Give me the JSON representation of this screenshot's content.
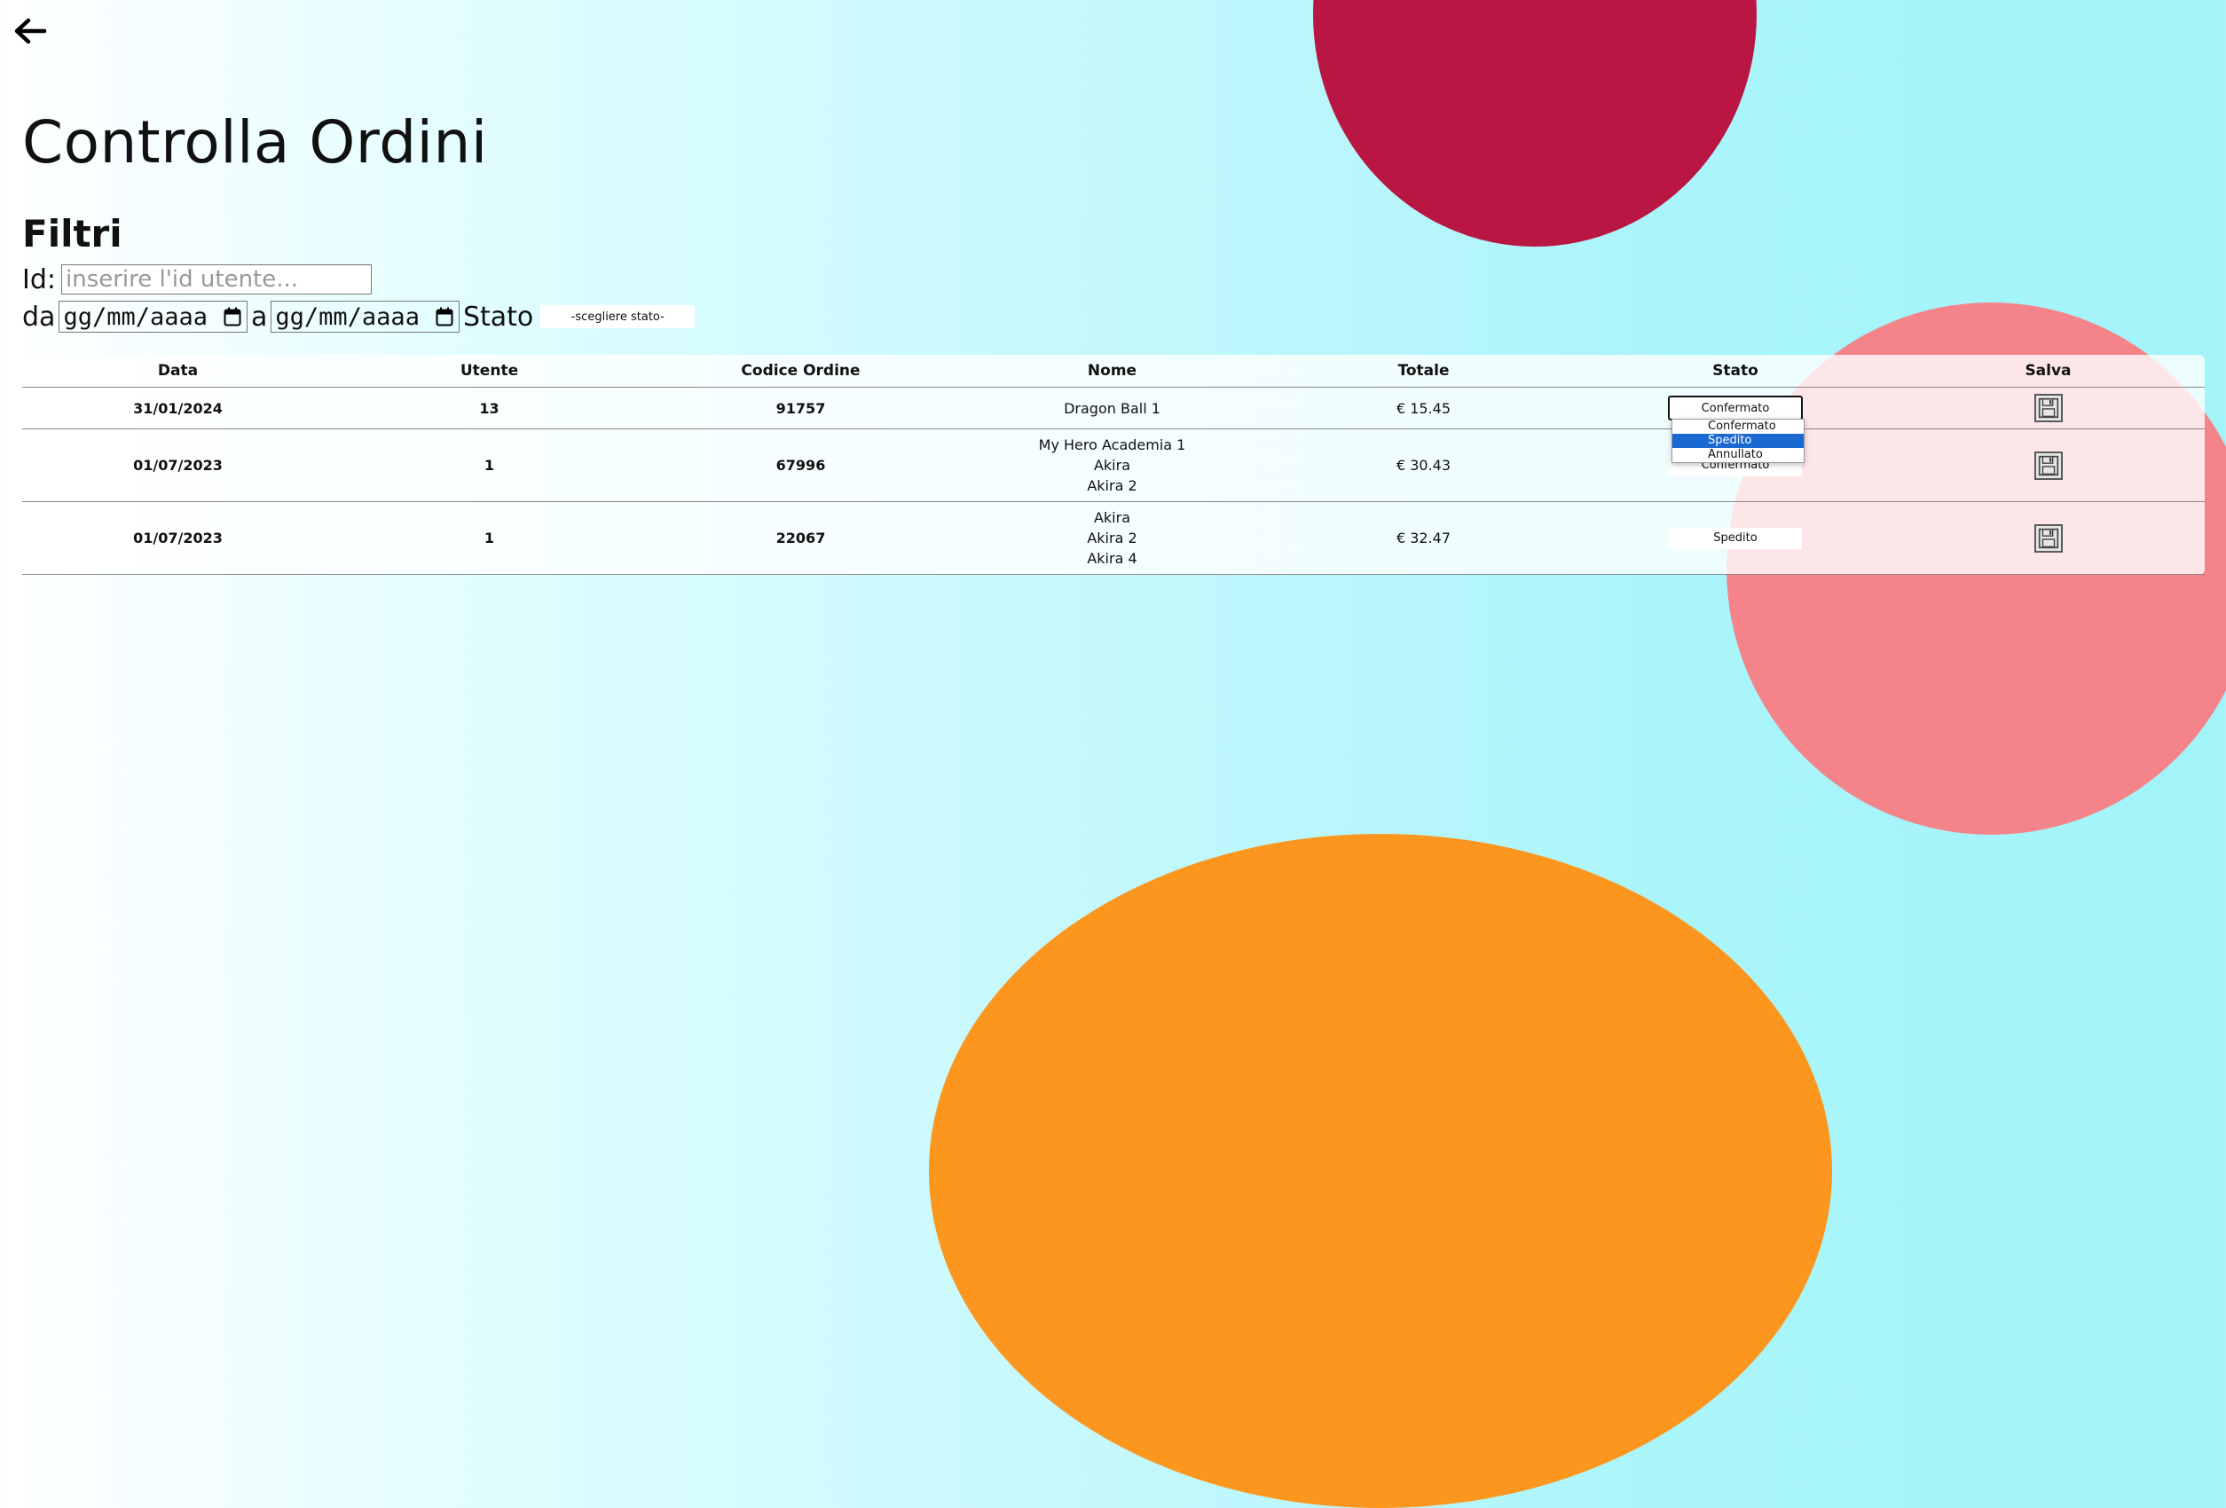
{
  "page": {
    "title": "Controlla Ordini"
  },
  "filters": {
    "heading": "Filtri",
    "id_label": "Id:",
    "id_placeholder": "inserire l'id utente...",
    "from_label": "da",
    "from_placeholder": "gg/mm/aaaa",
    "to_label": "a",
    "to_placeholder": "gg/mm/aaaa",
    "stato_label": "Stato",
    "stato_value": "-scegliere stato-"
  },
  "table": {
    "headers": [
      "Data",
      "Utente",
      "Codice Ordine",
      "Nome",
      "Totale",
      "Stato",
      "Salva"
    ],
    "rows": [
      {
        "data": "31/01/2024",
        "utente": "13",
        "codice": "91757",
        "nomi": [
          "Dragon Ball 1"
        ],
        "totale": "€ 15.45",
        "stato": "Confermato"
      },
      {
        "data": "01/07/2023",
        "utente": "1",
        "codice": "67996",
        "nomi": [
          "My Hero Academia 1",
          "Akira",
          "Akira 2"
        ],
        "totale": "€ 30.43",
        "stato": "Confermato"
      },
      {
        "data": "01/07/2023",
        "utente": "1",
        "codice": "22067",
        "nomi": [
          "Akira",
          "Akira 2",
          "Akira 4"
        ],
        "totale": "€ 32.47",
        "stato": "Spedito"
      }
    ]
  },
  "dropdown": {
    "options": [
      "Confermato",
      "Spedito",
      "Annullato"
    ],
    "highlighted": "Spedito"
  },
  "colors": {
    "blob_crimson": "#b91643",
    "blob_pink": "#f5838a",
    "blob_orange": "#fc961e",
    "selection_blue": "#1a68d2"
  },
  "icons": {
    "back": "arrow-left-icon",
    "save": "floppy-disk-icon",
    "calendar": "calendar-icon"
  }
}
